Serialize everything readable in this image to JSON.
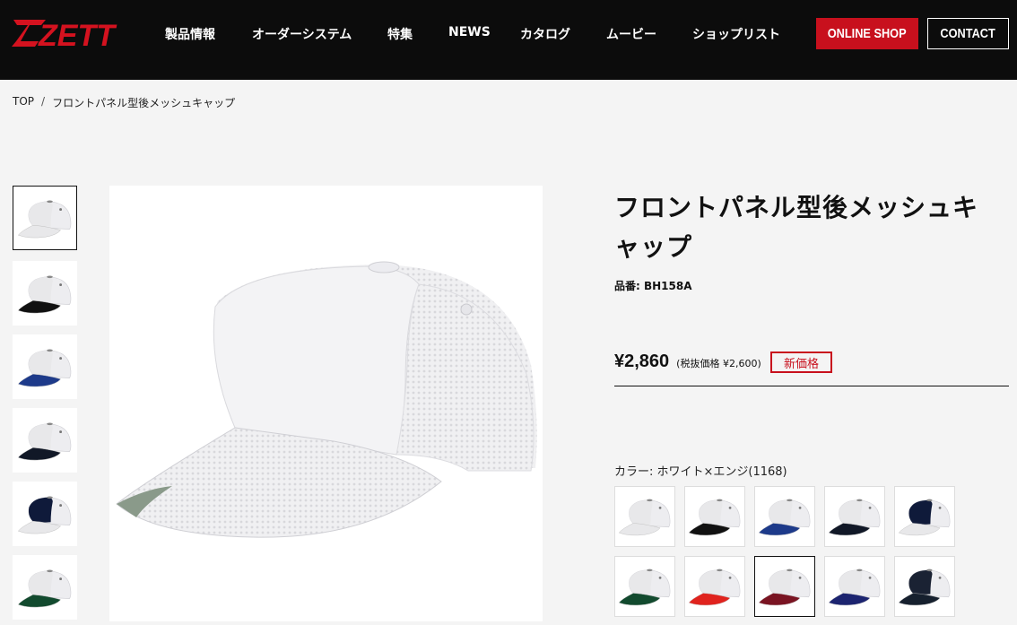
{
  "header": {
    "logo_text": "ZETT",
    "nav": [
      "製品情報",
      "オーダーシステム",
      "特集",
      "NEWS",
      "カタログ",
      "ムービー",
      "ショップリスト"
    ],
    "online_shop_label": "ONLINE SHOP",
    "contact_label": "CONTACT",
    "brand_color": "#c8101d"
  },
  "breadcrumb": {
    "home": "TOP",
    "separator": "/",
    "current": "フロントパネル型後メッシュキャップ"
  },
  "product": {
    "title": "フロントパネル型後メッシュキャップ",
    "part_number": "品番: BH158A",
    "price": "¥2,860",
    "tax_note": "(税抜価格 ¥2,600)",
    "badge": "新価格",
    "color_label": "カラー: ホワイト×エンジ(1168)"
  },
  "thumbnails": [
    {
      "brim": "#e8e8ea",
      "panel": "#e8e8ea"
    },
    {
      "brim": "#111111",
      "panel": "#e8e8ea"
    },
    {
      "brim": "#1d3a8a",
      "panel": "#e8e8ea"
    },
    {
      "brim": "#111827",
      "panel": "#e8e8ea"
    },
    {
      "brim": "#e8e8ea",
      "panel": "#0f1a3a"
    },
    {
      "brim": "#124a2e",
      "panel": "#e8e8ea"
    }
  ],
  "swatches": [
    {
      "brim": "#e8e8ea",
      "panel": "#e8e8ea"
    },
    {
      "brim": "#111111",
      "panel": "#e8e8ea"
    },
    {
      "brim": "#1d3a8a",
      "panel": "#e8e8ea"
    },
    {
      "brim": "#111827",
      "panel": "#e8e8ea"
    },
    {
      "brim": "#e8e8ea",
      "panel": "#0f1a3a"
    },
    {
      "brim": "#124a2e",
      "panel": "#e8e8ea"
    },
    {
      "brim": "#e0231e",
      "panel": "#e8e8ea"
    },
    {
      "brim": "#7a1422",
      "panel": "#e8e8ea"
    },
    {
      "brim": "#1c2470",
      "panel": "#e8e8ea"
    },
    {
      "brim": "#16202e",
      "panel": "#1a2233"
    }
  ]
}
